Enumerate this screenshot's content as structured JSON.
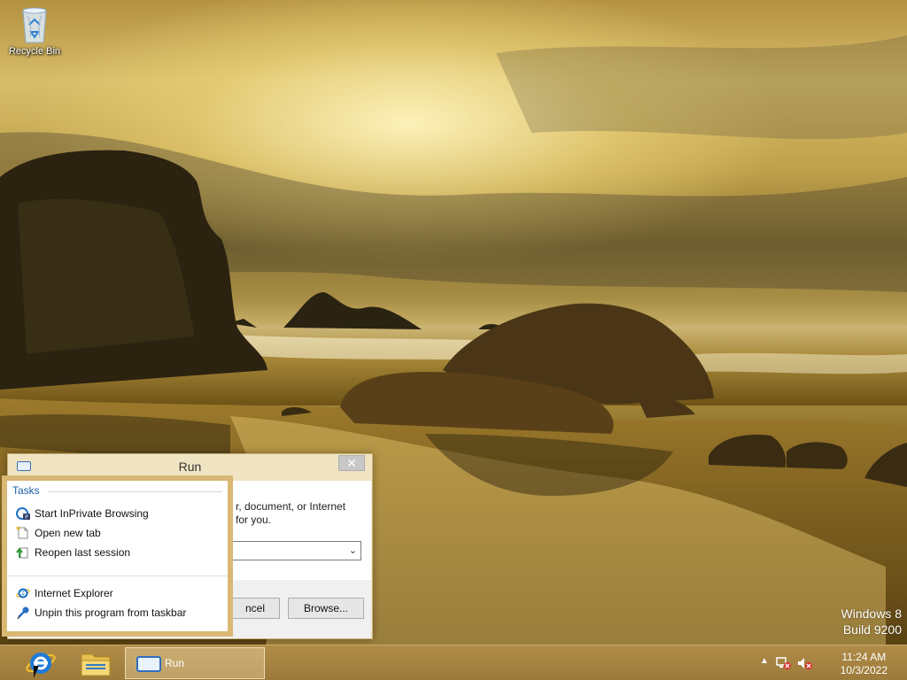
{
  "desktop": {
    "recycle_bin_label": "Recycle Bin",
    "watermark_line1": "Windows 8",
    "watermark_line2": "Build 9200"
  },
  "run_dialog": {
    "title": "Run",
    "description_line1": "r, document, or Internet",
    "description_line2": "for you.",
    "cancel_label": "ncel",
    "browse_label": "Browse...",
    "close_glyph": "✕"
  },
  "jumplist": {
    "tasks_header": "Tasks",
    "items": [
      {
        "label": "Start InPrivate Browsing",
        "icon": "inprivate-icon"
      },
      {
        "label": "Open new tab",
        "icon": "new-tab-icon"
      },
      {
        "label": "Reopen last session",
        "icon": "reopen-session-icon"
      }
    ],
    "program_items": [
      {
        "label": "Internet Explorer",
        "icon": "internet-explorer-icon"
      },
      {
        "label": "Unpin this program from taskbar",
        "icon": "unpin-icon"
      }
    ]
  },
  "taskbar": {
    "run_label": "Run",
    "time": "11:24 AM",
    "date": "10/3/2022",
    "show_hidden_glyph": "▲"
  },
  "colors": {
    "accent_gold": "#d9b874",
    "ie_blue": "#1e73c8",
    "jumplist_header": "#1e5fa8"
  }
}
